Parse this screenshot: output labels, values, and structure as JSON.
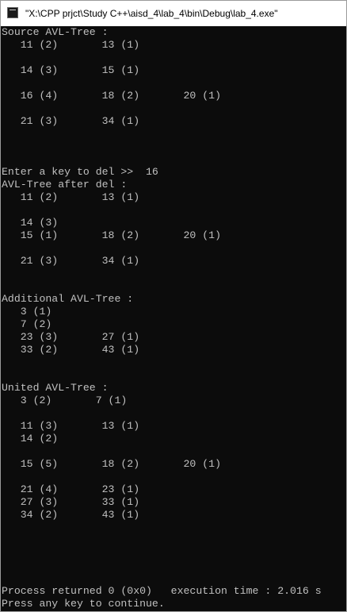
{
  "window": {
    "title": "\"X:\\CPP prjct\\Study C++\\aisd_4\\lab_4\\bin\\Debug\\lab_4.exe\""
  },
  "console": {
    "lines": [
      "Source AVL-Tree :",
      "   11 (2)       13 (1)",
      "",
      "   14 (3)       15 (1)",
      "",
      "   16 (4)       18 (2)       20 (1)",
      "",
      "   21 (3)       34 (1)",
      "",
      "",
      "",
      "Enter a key to del >>  16",
      "AVL-Tree after del :",
      "   11 (2)       13 (1)",
      "",
      "   14 (3)",
      "   15 (1)       18 (2)       20 (1)",
      "",
      "   21 (3)       34 (1)",
      "",
      "",
      "Additional AVL-Tree :",
      "   3 (1)",
      "   7 (2)",
      "   23 (3)       27 (1)",
      "   33 (2)       43 (1)",
      "",
      "",
      "United AVL-Tree :",
      "   3 (2)       7 (1)",
      "",
      "   11 (3)       13 (1)",
      "   14 (2)",
      "",
      "   15 (5)       18 (2)       20 (1)",
      "",
      "   21 (4)       23 (1)",
      "   27 (3)       33 (1)",
      "   34 (2)       43 (1)",
      "",
      "",
      "",
      "",
      "",
      "Process returned 0 (0x0)   execution time : 2.016 s",
      "Press any key to continue."
    ]
  }
}
